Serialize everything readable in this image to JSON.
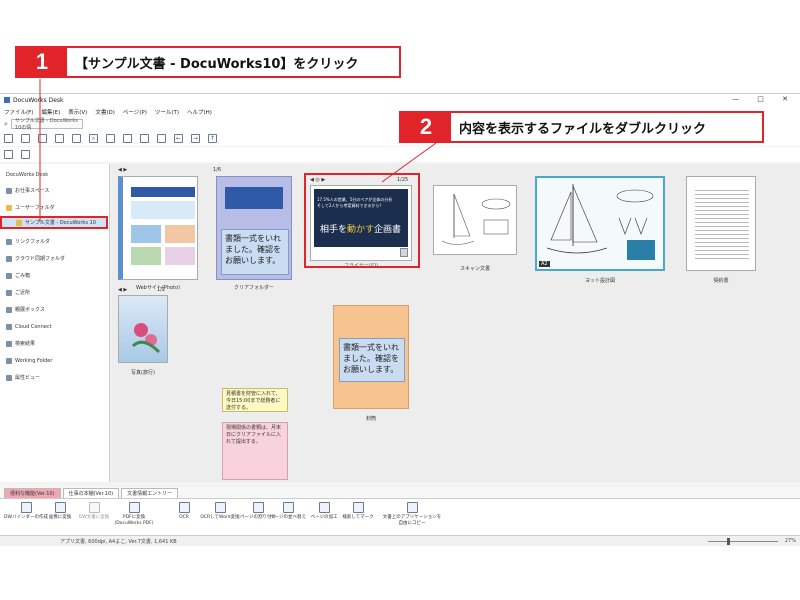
{
  "callout1": {
    "num": "1",
    "text": "【サンプル文書 - DocuWorks10】をクリック"
  },
  "callout2": {
    "num": "2",
    "text": "内容を表示するファイルをダブルクリック"
  },
  "window": {
    "title": "DocuWorks Desk",
    "menu": [
      "ファイル(F)",
      "編集(E)",
      "表示(V)",
      "文書(D)",
      "ページ(P)",
      "ツール(T)",
      "ヘルプ(H)"
    ],
    "breadcrumb": "サンプル文書 - DocuWorks 10の情"
  },
  "sidebar": {
    "items": [
      {
        "label": "DocuWorks Desk"
      },
      {
        "label": "お仕事スペース"
      },
      {
        "label": "ユーザーフォルダ"
      },
      {
        "label": "サンプル文書 - DocuWorks 10"
      },
      {
        "label": "リンクフォルダ"
      },
      {
        "label": "クラウド同期フォルダ"
      },
      {
        "label": "ごみ箱"
      },
      {
        "label": "ご近所"
      },
      {
        "label": "親展ボックス"
      },
      {
        "label": "Cloud Connect"
      },
      {
        "label": "検索結果"
      },
      {
        "label": "Working Folder"
      },
      {
        "label": "属性ビュー"
      }
    ]
  },
  "documents": [
    {
      "label": "Webサイト(Photo)",
      "pager": "1/6"
    },
    {
      "label": "クリアフォルダー",
      "note": "書類一式をいれました。確認をお願いします。"
    },
    {
      "label": "フライヤー(ID)",
      "pager": "1/25",
      "flyer_line1": "17.5%人の営業、5分のペアが全体の分析",
      "flyer_line2": "そして2人から考案資料できるから？",
      "flyer_head_a": "相手を",
      "flyer_head_b": "動かす",
      "flyer_head_c": "企画書"
    },
    {
      "label": "スキャン文書"
    },
    {
      "label": "ヨット設計図",
      "badge": "A2"
    },
    {
      "label": "契約書"
    },
    {
      "label": "写真(旅行)",
      "pager": "1/2"
    },
    {
      "label": "封筒",
      "note": "書類一式をいれました。確認をお願いします。"
    }
  ],
  "stickies": [
    {
      "text": "見積書を財管に入れて、今日15:00まで総務者に送付する。"
    },
    {
      "text": "現場関係の書類は、月末日にクリアファイルに入れて提出する。"
    }
  ],
  "bottom_tabs": [
    "便利な機能(Ver.10)",
    "仕事の本棚(Ver.10)",
    "文書情報エントリー"
  ],
  "tools": [
    "DWバインダーの作成",
    "画像に変換",
    "DW文書に変換",
    "PDFに変換(DocuWorks PDF)",
    "OCR",
    "OCRしてWord変換",
    "ページの割り付け",
    "ページの並べ替え",
    "ページの加工",
    "検索してマーク",
    "文書上のアプリケーションを自由にコピー"
  ],
  "status": {
    "text": "アプリ文書, 600dpi, A4よこ, Ver.7文書, 1,641 KB",
    "zoom": "27%",
    "zoom_level": 0.27
  },
  "colors": {
    "accent": "#e0242a",
    "selection": "#cfe3f7",
    "note_blue": "#c9dcf2",
    "note_orange": "#f7c48f",
    "sticky_yellow": "#fff9c4",
    "sticky_pink": "#f9d3dc"
  }
}
